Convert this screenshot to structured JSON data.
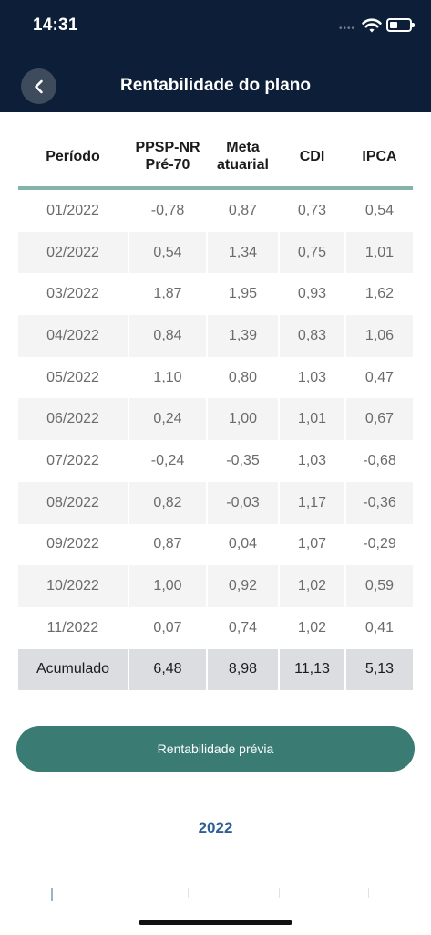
{
  "status_bar": {
    "time": "14:31",
    "signal_dots": "••••",
    "wifi_icon": "wifi-icon",
    "battery_icon": "battery-icon"
  },
  "header": {
    "title": "Rentabilidade do plano",
    "back_icon": "chevron-left-icon"
  },
  "table": {
    "columns": [
      "Período",
      "PPSP-NR Pré-70",
      "Meta atuarial",
      "CDI",
      "IPCA"
    ],
    "rows": [
      [
        "01/2022",
        "-0,78",
        "0,87",
        "0,73",
        "0,54"
      ],
      [
        "02/2022",
        "0,54",
        "1,34",
        "0,75",
        "1,01"
      ],
      [
        "03/2022",
        "1,87",
        "1,95",
        "0,93",
        "1,62"
      ],
      [
        "04/2022",
        "0,84",
        "1,39",
        "0,83",
        "1,06"
      ],
      [
        "05/2022",
        "1,10",
        "0,80",
        "1,03",
        "0,47"
      ],
      [
        "06/2022",
        "0,24",
        "1,00",
        "1,01",
        "0,67"
      ],
      [
        "07/2022",
        "-0,24",
        "-0,35",
        "1,03",
        "-0,68"
      ],
      [
        "08/2022",
        "0,82",
        "-0,03",
        "1,17",
        "-0,36"
      ],
      [
        "09/2022",
        "0,87",
        "0,04",
        "1,07",
        "-0,29"
      ],
      [
        "10/2022",
        "1,00",
        "0,92",
        "1,02",
        "0,59"
      ],
      [
        "11/2022",
        "0,07",
        "0,74",
        "1,02",
        "0,41"
      ]
    ],
    "total": [
      "Acumulado",
      "6,48",
      "8,98",
      "11,13",
      "5,13"
    ]
  },
  "button": {
    "label": "Rentabilidade prévia"
  },
  "year_selector": {
    "label": "2022"
  },
  "colors": {
    "header_bg": "#0d1f38",
    "accent": "#3a7c73",
    "year": "#2f5f94",
    "divider": "#84b3ae"
  }
}
